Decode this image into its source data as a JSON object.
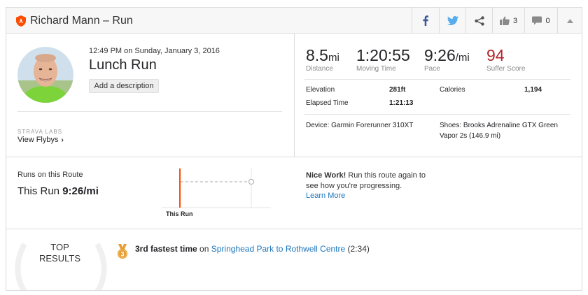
{
  "header": {
    "title": "Richard Mann – Run",
    "kudos_count": "3",
    "comments_count": "0"
  },
  "activity": {
    "datetime": "12:49 PM on Sunday, January 3, 2016",
    "title": "Lunch Run",
    "add_description_label": "Add a description",
    "labs_label": "STRAVA LABS",
    "flyby_label": "View Flybys",
    "flyby_chevron": "›"
  },
  "stats": {
    "distance": {
      "value": "8.5",
      "unit": "mi",
      "label": "Distance"
    },
    "moving_time": {
      "value": "1:20:55",
      "label": "Moving Time"
    },
    "pace": {
      "value": "9:26",
      "unit": "/mi",
      "label": "Pace"
    },
    "suffer": {
      "value": "94",
      "label": "Suffer Score"
    }
  },
  "details": {
    "elevation_label": "Elevation",
    "elevation_value": "281ft",
    "calories_label": "Calories",
    "calories_value": "1,194",
    "elapsed_label": "Elapsed Time",
    "elapsed_value": "1:21:13",
    "device": "Device: Garmin Forerunner 310XT",
    "shoes_line1": "Shoes: Brooks Adrenaline GTX Green",
    "shoes_line2": "Vapor 2s (146.9 mi)"
  },
  "route": {
    "heading": "Runs on this Route",
    "this_run_prefix": "This Run",
    "this_run_pace": "9:26/mi",
    "chart_label": "This Run",
    "nice_bold": "Nice Work!",
    "nice_text": "Run this route again to see how you're progressing.",
    "learn_more": "Learn More"
  },
  "top_results": {
    "title_line1": "TOP",
    "title_line2": "RESULTS",
    "medal_number": "3",
    "achievement_bold": "3rd fastest time",
    "achievement_on": "on",
    "segment_name": "Springhead Park to Rothwell Centre",
    "segment_time": "(2:34)"
  },
  "colors": {
    "brand_orange": "#fc4c02",
    "suffer_red": "#b1262c",
    "facebook_blue": "#3b5998",
    "twitter_blue": "#55acee",
    "link_blue": "#1c75bc",
    "medal_bronze": "#e59b31"
  },
  "icons": {
    "shield": "activity-type-shield-icon",
    "facebook": "facebook-icon",
    "twitter": "twitter-icon",
    "share": "share-icon",
    "kudos": "thumbs-up-icon",
    "comment": "comment-icon",
    "collapse": "caret-up-icon",
    "medal": "medal-icon"
  }
}
